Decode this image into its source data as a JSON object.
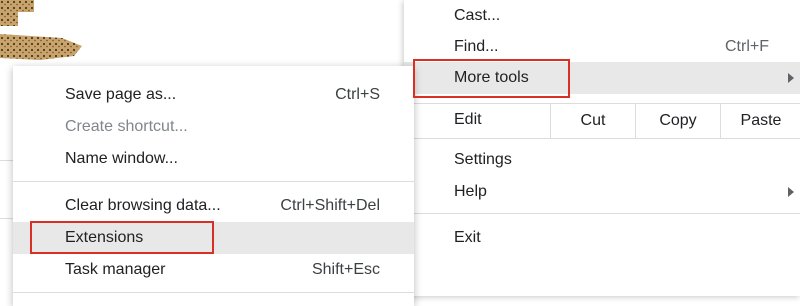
{
  "main_menu": {
    "cast": "Cast...",
    "find": {
      "label": "Find...",
      "shortcut": "Ctrl+F"
    },
    "more_tools": "More tools",
    "edit": {
      "label": "Edit",
      "cut": "Cut",
      "copy": "Copy",
      "paste": "Paste"
    },
    "settings": "Settings",
    "help": "Help",
    "exit": "Exit"
  },
  "submenu": {
    "save_page": {
      "label": "Save page as...",
      "shortcut": "Ctrl+S"
    },
    "create_shortcut": "Create shortcut...",
    "name_window": "Name window...",
    "clear_browsing": {
      "label": "Clear browsing data...",
      "shortcut": "Ctrl+Shift+Del"
    },
    "extensions": "Extensions",
    "task_manager": {
      "label": "Task manager",
      "shortcut": "Shift+Esc"
    }
  },
  "colors": {
    "highlight_box": "#d93025",
    "hover_bg": "#e8e8e8"
  }
}
